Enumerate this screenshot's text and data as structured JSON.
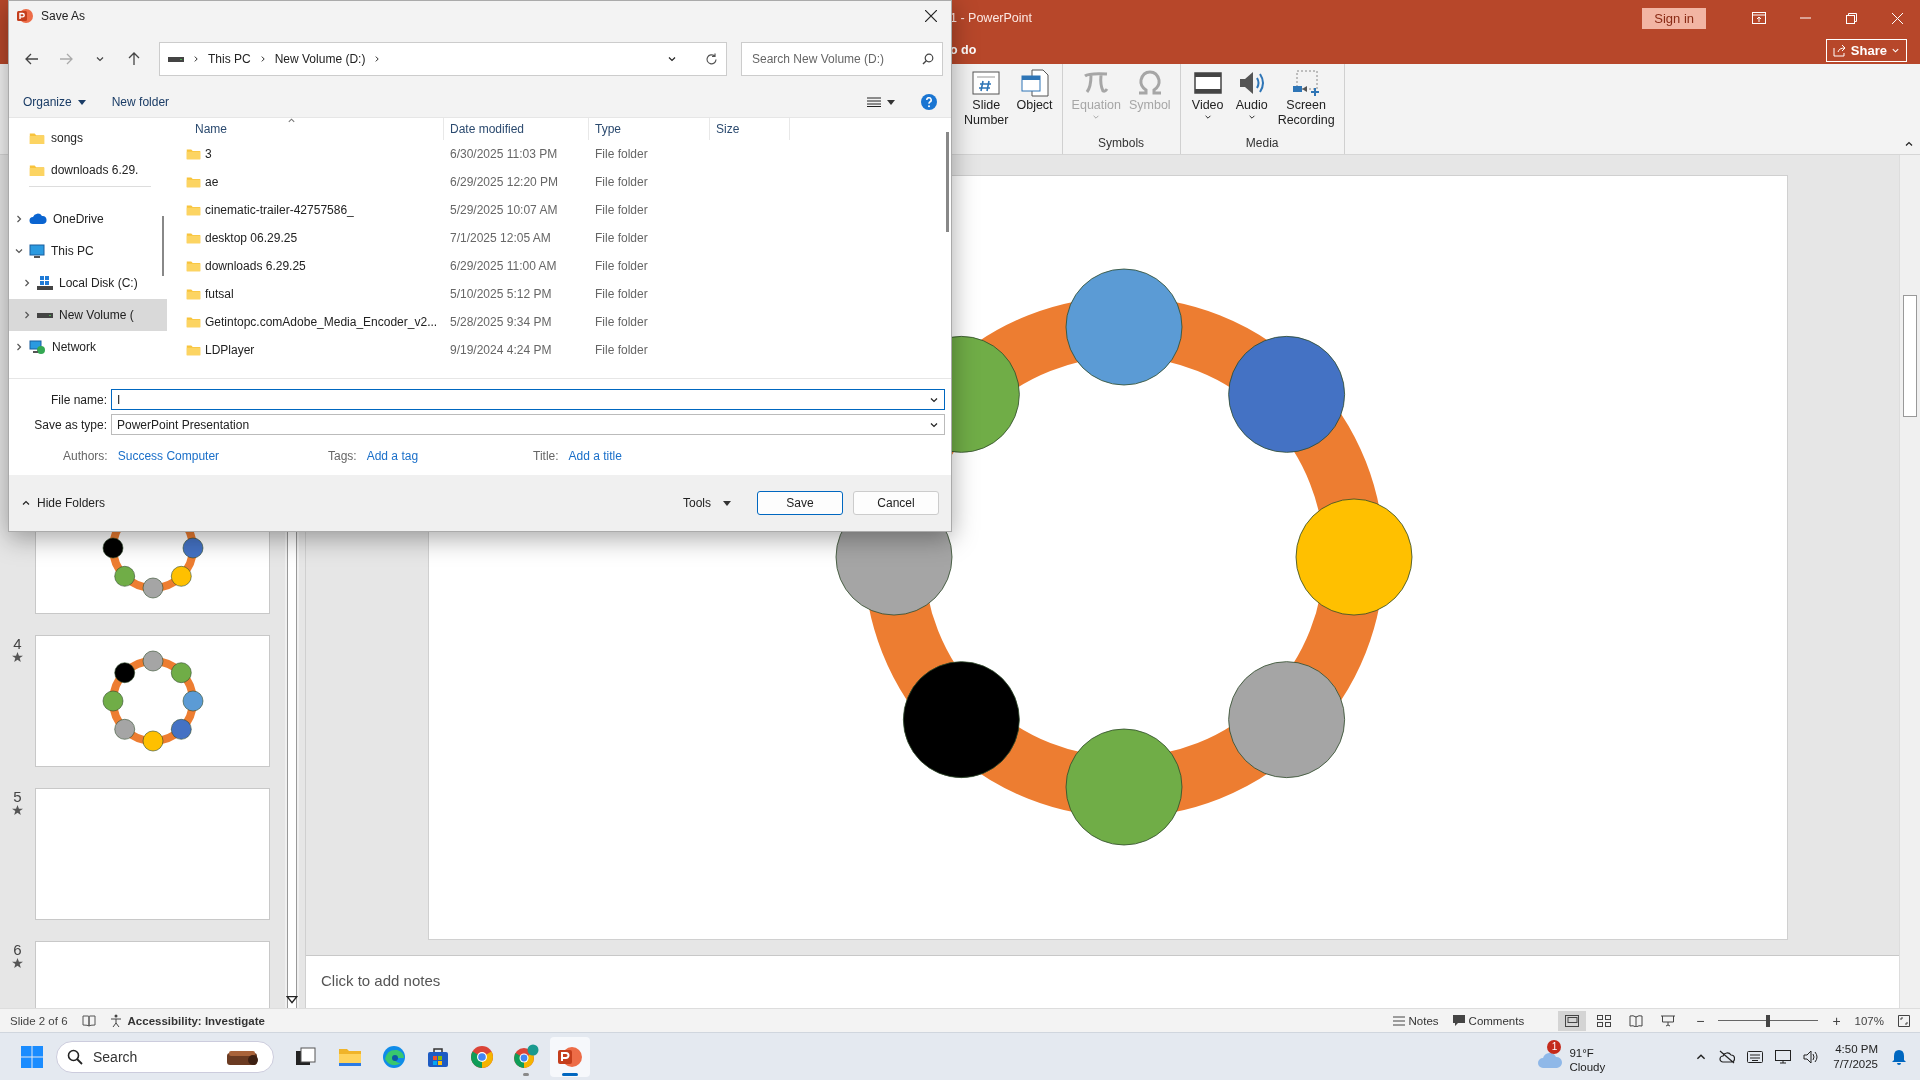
{
  "app_window": {
    "title": "1  -  PowerPoint",
    "tell_me": "o do",
    "sign_in": "Sign in",
    "share": "Share"
  },
  "ribbon": {
    "groups": [
      {
        "buttons": [
          {
            "kind": "slide-number",
            "label": "Slide Number",
            "disabled": false,
            "dropdown": false
          },
          {
            "kind": "object",
            "label": "Object",
            "disabled": false,
            "dropdown": false
          }
        ]
      },
      {
        "label": "Symbols",
        "buttons": [
          {
            "kind": "equation",
            "label": "Equation",
            "disabled": true,
            "dropdown": true
          },
          {
            "kind": "symbol",
            "label": "Symbol",
            "disabled": true,
            "dropdown": false
          }
        ]
      },
      {
        "label": "Media",
        "buttons": [
          {
            "kind": "video",
            "label": "Video",
            "disabled": false,
            "dropdown": true
          },
          {
            "kind": "audio",
            "label": "Audio",
            "disabled": false,
            "dropdown": true
          },
          {
            "kind": "screen-recording",
            "label": "Screen Recording",
            "disabled": false,
            "dropdown": false
          }
        ]
      }
    ]
  },
  "slides": [
    {
      "kind": "ring-a"
    },
    {
      "number": "4",
      "kind": "ring-b",
      "animated": true
    },
    {
      "number": "5",
      "kind": "blank",
      "animated": true
    },
    {
      "number": "6",
      "kind": "blank",
      "animated": true
    }
  ],
  "editor": {
    "notes_placeholder": "Click to add notes"
  },
  "status_bar": {
    "slide_indicator": "Slide 2 of 6",
    "accessibility": "Accessibility: Investigate",
    "notes": "Notes",
    "comments": "Comments",
    "views": [
      {
        "kind": "normal",
        "selected": true
      },
      {
        "kind": "sorter",
        "selected": false
      },
      {
        "kind": "reading",
        "selected": false
      },
      {
        "kind": "slideshow",
        "selected": false
      }
    ],
    "zoom": {
      "minus": "−",
      "plus": "+",
      "level": 0.5,
      "reading": "107%"
    }
  },
  "taskbar": {
    "search_placeholder": "Search",
    "apps": [
      {
        "kind": "task-view",
        "running": false,
        "active": false
      },
      {
        "kind": "explorer",
        "running": false,
        "active": false
      },
      {
        "kind": "edge",
        "running": false,
        "active": false
      },
      {
        "kind": "store",
        "running": false,
        "active": false
      },
      {
        "kind": "chrome",
        "running": false,
        "active": false
      },
      {
        "kind": "chrome-profile",
        "running": true,
        "active": false
      },
      {
        "kind": "powerpoint",
        "running": true,
        "active": true
      }
    ],
    "weather": {
      "badge": "1",
      "temperature": "91°F",
      "condition": "Cloudy"
    },
    "clock": {
      "time": "4:50 PM",
      "date": "7/7/2025"
    }
  },
  "dialog": {
    "title": "Save As",
    "path": [
      "This PC",
      "New Volume (D:)"
    ],
    "search_placeholder": "Search New Volume (D:)",
    "organize": "Organize",
    "new_folder": "New folder",
    "nav_tree": [
      {
        "label": "songs",
        "kind": "folder",
        "selected": false
      },
      {
        "label": "downloads 6.29.",
        "kind": "folder",
        "selected": false
      },
      {
        "label": "OneDrive",
        "kind": "cloud",
        "expanded": false,
        "selected": false
      },
      {
        "label": "This PC",
        "kind": "pc",
        "expanded": true,
        "selected": false,
        "children": [
          {
            "label": "Local Disk (C:)",
            "kind": "windows-drive",
            "expanded": false,
            "selected": false
          },
          {
            "label": "New Volume (",
            "kind": "drive",
            "expanded": false,
            "selected": true
          }
        ]
      },
      {
        "label": "Network",
        "kind": "network",
        "expanded": false,
        "selected": false
      }
    ],
    "columns": [
      "Name",
      "Date modified",
      "Type",
      "Size"
    ],
    "files": [
      {
        "name": "3",
        "date_modified": "6/30/2025 11:03 PM",
        "type": "File folder"
      },
      {
        "name": "ae",
        "date_modified": "6/29/2025 12:20 PM",
        "type": "File folder"
      },
      {
        "name": "cinematic-trailer-42757586_",
        "date_modified": "5/29/2025 10:07 AM",
        "type": "File folder"
      },
      {
        "name": "desktop 06.29.25",
        "date_modified": "7/1/2025 12:05 AM",
        "type": "File folder"
      },
      {
        "name": "downloads 6.29.25",
        "date_modified": "6/29/2025 11:00 AM",
        "type": "File folder"
      },
      {
        "name": "futsal",
        "date_modified": "5/10/2025 5:12 PM",
        "type": "File folder"
      },
      {
        "name": "Getintopc.comAdobe_Media_Encoder_v2...",
        "date_modified": "5/28/2025 9:34 PM",
        "type": "File folder"
      },
      {
        "name": "LDPlayer",
        "date_modified": "9/19/2024 4:24 PM",
        "type": "File folder"
      }
    ],
    "file_name": {
      "label": "File name:",
      "value": "I"
    },
    "save_as_type": {
      "label": "Save as type:",
      "value": "PowerPoint Presentation"
    },
    "meta": [
      {
        "label": "Authors:",
        "value": "Success Computer"
      },
      {
        "label": "Tags:",
        "value": "Add a tag"
      },
      {
        "label": "Title:",
        "value": "Add a title"
      }
    ],
    "hide_folders": "Hide Folders",
    "tools": "Tools",
    "buttons": [
      {
        "label": "Save",
        "kind": "primary"
      },
      {
        "label": "Cancel",
        "kind": "secondary"
      }
    ]
  }
}
